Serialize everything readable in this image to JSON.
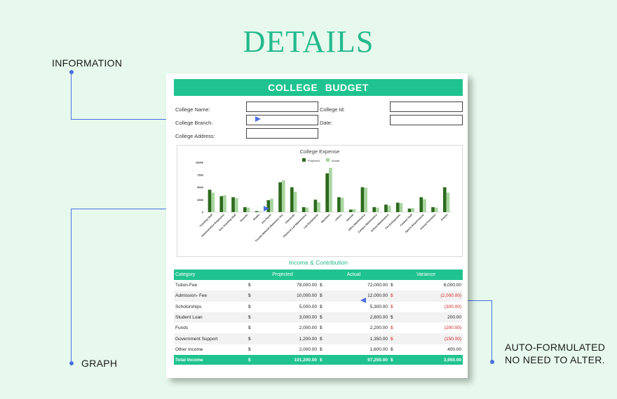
{
  "page_title": "DETAILS",
  "callouts": {
    "information": "INFORMATION",
    "graph": "GRAPH",
    "auto_line1": "AUTO-FORMULATED",
    "auto_line2": "NO NEED TO ALTER."
  },
  "colors": {
    "accent": "#20c38f",
    "title": "#23b98c",
    "callout_line": "#4a6fe0",
    "projected": "#2d6a1e",
    "actual": "#a9d6a0",
    "negative": "#d22020",
    "background": "#e6f9ec"
  },
  "sheet": {
    "banner": "COLLEGE BUDGET",
    "fields": {
      "college_name": "College Name:",
      "college_branch": "College Branch:",
      "college_address": "College Address:",
      "college_id": "College Id:",
      "date": "Date:"
    }
  },
  "chart_data": {
    "type": "bar",
    "title": "College Expense",
    "series": [
      {
        "name": "Projected",
        "values": [
          4500,
          3200,
          3000,
          1000,
          200,
          2400,
          6000,
          5000,
          1000,
          2500,
          7800,
          3000,
          500,
          5000,
          1000,
          1500,
          1900,
          700,
          3000,
          1000,
          5000
        ]
      },
      {
        "name": "Actual",
        "values": [
          3900,
          3400,
          2800,
          900,
          150,
          2700,
          6400,
          4100,
          900,
          2000,
          8900,
          2900,
          600,
          4900,
          900,
          1300,
          1800,
          800,
          2600,
          900,
          3900
        ]
      }
    ],
    "categories": [
      "Teaching Staff",
      "Administrative Employees",
      "Non-Teaching Staff",
      "Security",
      "Books",
      "Arts Room",
      "Faculty Material (Stationery etc)",
      "Chemicals",
      "Chemical Lab Maintenance",
      "Lab Equipments",
      "Machines",
      "Library",
      "Internet",
      "Office Maintenance",
      "Campus Maintenance",
      "School Maintenance",
      "Fire Extinguisher",
      "Canteen Staff",
      "Sports Requirements",
      "Annual Functions",
      "Events"
    ],
    "yticks": [
      "0",
      "2500",
      "5000",
      "7500",
      "10000"
    ],
    "ylim": [
      0,
      10000
    ],
    "legend": "top-center",
    "grid": false
  },
  "income": {
    "title": "Income & Contribution",
    "headers": [
      "Category",
      "Projected",
      "Actual",
      "Variance"
    ],
    "currency": "$",
    "rows": [
      {
        "category": "Tution-Fee",
        "projected": "78,000.00",
        "actual": "72,000.00",
        "variance": "6,000.00",
        "negative": false
      },
      {
        "category": "Admission- Fee",
        "projected": "10,000.00",
        "actual": "12,000.00",
        "variance": "(2,000.00)",
        "negative": true
      },
      {
        "category": "Scholorships",
        "projected": "5,000.00",
        "actual": "5,300.00",
        "variance": "(300.00)",
        "negative": true
      },
      {
        "category": "Student Loan",
        "projected": "3,000.00",
        "actual": "2,800.00",
        "variance": "200.00",
        "negative": false
      },
      {
        "category": "Funds",
        "projected": "2,000.00",
        "actual": "2,200.00",
        "variance": "(200.00)",
        "negative": true
      },
      {
        "category": "Government Support",
        "projected": "1,200.00",
        "actual": "1,350.00",
        "variance": "(150.00)",
        "negative": true
      },
      {
        "category": "Other Income",
        "projected": "2,000.00",
        "actual": "1,600.00",
        "variance": "400.00",
        "negative": false
      }
    ],
    "total": {
      "category": "Total Income",
      "projected": "101,200.00",
      "actual": "97,250.00",
      "variance": "3,950.00"
    }
  }
}
